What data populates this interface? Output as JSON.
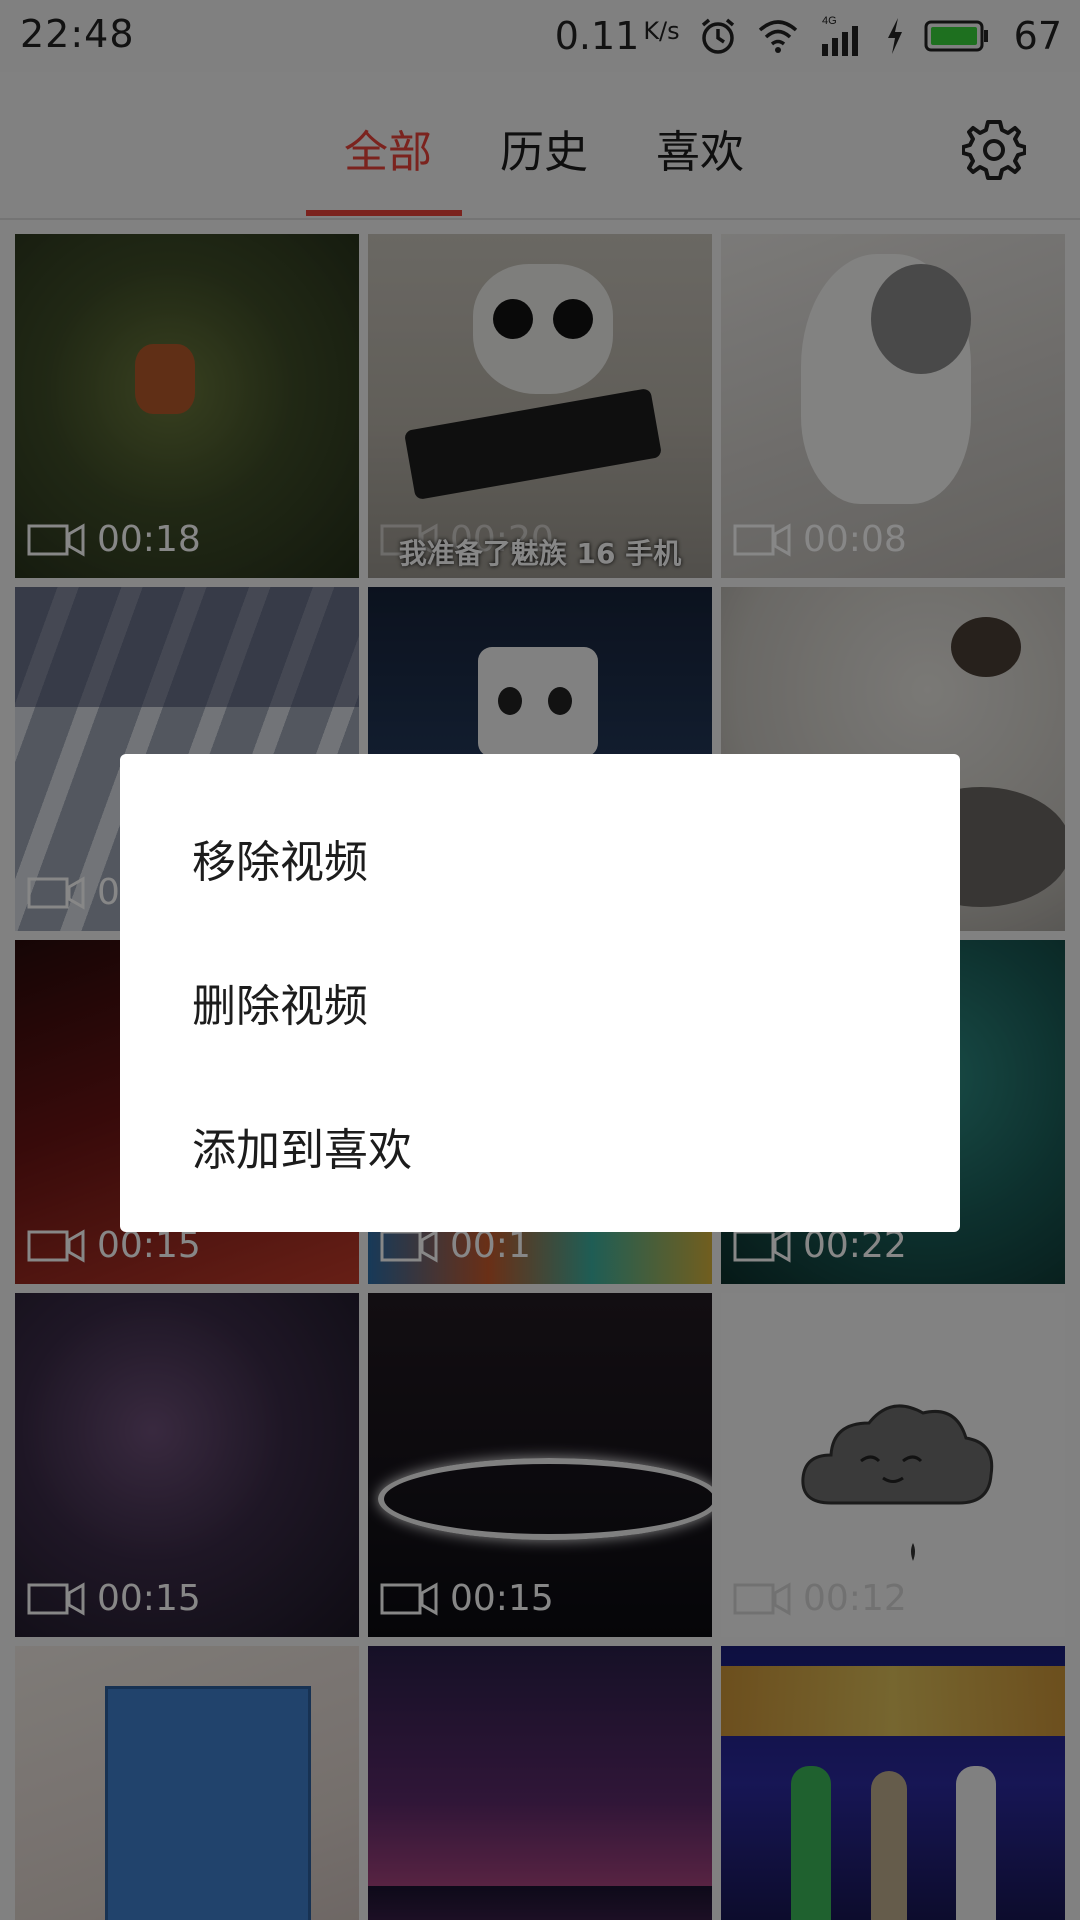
{
  "status_bar": {
    "time": "22:48",
    "net_speed": "0.11",
    "net_unit": "K/s",
    "battery_percent": "67",
    "icons": [
      "alarm-icon",
      "wifi-icon",
      "signal-4g-icon",
      "charging-icon",
      "battery-icon"
    ]
  },
  "tabs": [
    {
      "label": "全部",
      "active": true
    },
    {
      "label": "历史",
      "active": false
    },
    {
      "label": "喜欢",
      "active": false
    }
  ],
  "accent_color": "#e8423a",
  "settings_icon": "gear-icon",
  "videos": [
    {
      "duration": "00:18",
      "caption": ""
    },
    {
      "duration": "00:20",
      "caption": "我准备了魅族 16 手机"
    },
    {
      "duration": "00:08",
      "caption": ""
    },
    {
      "duration": "00:",
      "caption": ""
    },
    {
      "duration": "",
      "caption": ""
    },
    {
      "duration": "",
      "caption": ""
    },
    {
      "duration": "00:15",
      "caption": ""
    },
    {
      "duration": "00:1",
      "caption": ""
    },
    {
      "duration": "00:22",
      "caption": ""
    },
    {
      "duration": "00:15",
      "caption": ""
    },
    {
      "duration": "00:15",
      "caption": ""
    },
    {
      "duration": "00:12",
      "caption": ""
    },
    {
      "duration": "",
      "caption": ""
    },
    {
      "duration": "",
      "caption": ""
    },
    {
      "duration": "",
      "caption": ""
    }
  ],
  "dialog": {
    "items": [
      "移除视频",
      "删除视频",
      "添加到喜欢"
    ]
  }
}
